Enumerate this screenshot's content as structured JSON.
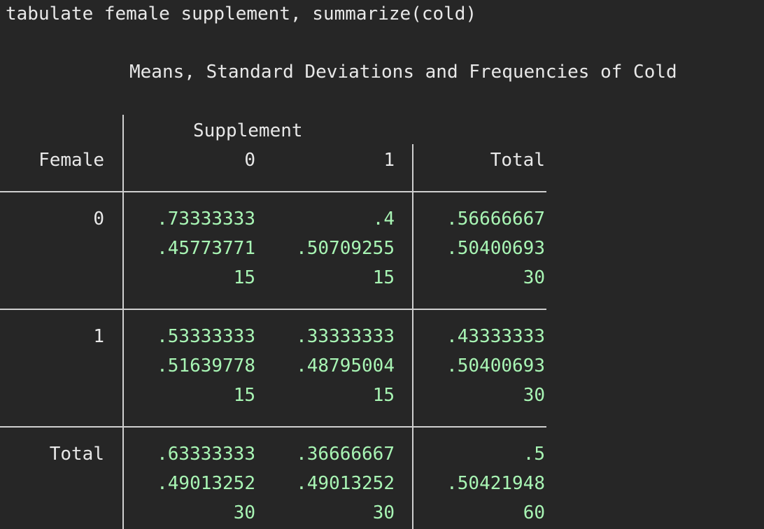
{
  "command": "tabulate female supplement, summarize(cold)",
  "table": {
    "title": "Means, Standard Deviations and Frequencies of Cold",
    "row_var_label": "Female",
    "col_var_label": "Supplement",
    "col_headers": [
      "0",
      "1",
      "Total"
    ],
    "rows": [
      {
        "label": "0",
        "cells": [
          [
            ".73333333",
            ".4",
            ".56666667"
          ],
          [
            ".45773771",
            ".50709255",
            ".50400693"
          ],
          [
            "15",
            "15",
            "30"
          ]
        ]
      },
      {
        "label": "1",
        "cells": [
          [
            ".53333333",
            ".33333333",
            ".43333333"
          ],
          [
            ".51639778",
            ".48795004",
            ".50400693"
          ],
          [
            "15",
            "15",
            "30"
          ]
        ]
      },
      {
        "label": "Total",
        "cells": [
          [
            ".63333333",
            ".36666667",
            ".5"
          ],
          [
            ".49013252",
            ".49013252",
            ".50421948"
          ],
          [
            "30",
            "30",
            "60"
          ]
        ]
      }
    ]
  },
  "colors": {
    "background": "#262626",
    "text": "#e8e8e8",
    "result_values": "#a8f5b4",
    "rules": "#cfcfcf"
  }
}
